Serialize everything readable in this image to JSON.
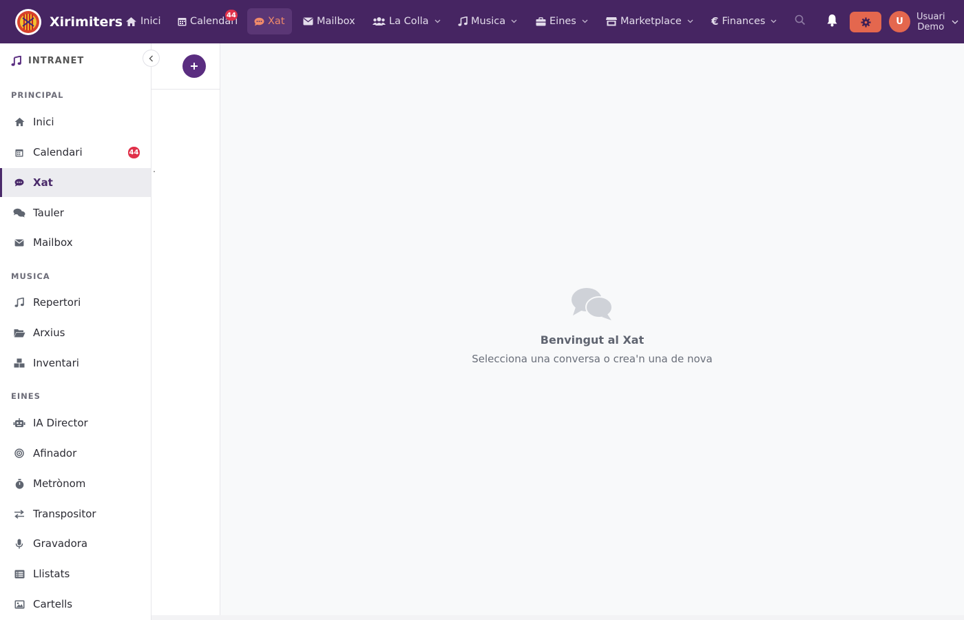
{
  "app": {
    "brand": "Xirimiters"
  },
  "topnav": {
    "items": [
      {
        "label": "Inici",
        "icon": "home-icon"
      },
      {
        "label": "Calendari",
        "icon": "calendar-icon",
        "badge": "44"
      },
      {
        "label": "Xat",
        "icon": "chat-icon",
        "active": true
      },
      {
        "label": "Mailbox",
        "icon": "envelope-icon"
      },
      {
        "label": "La Colla",
        "icon": "users-icon"
      },
      {
        "label": "Musica",
        "icon": "music-icon"
      },
      {
        "label": "Eines",
        "icon": "toolbox-icon"
      },
      {
        "label": "Marketplace",
        "icon": "store-icon"
      },
      {
        "label": "Finances",
        "icon": "euro-icon"
      }
    ],
    "user": {
      "initial": "U",
      "name_line1": "Usuari",
      "name_line2": "Demo"
    }
  },
  "sidebar": {
    "header": "INTRANET",
    "sections": [
      {
        "title": "PRINCIPAL",
        "items": [
          {
            "label": "Inici",
            "icon": "home-icon"
          },
          {
            "label": "Calendari",
            "icon": "calendar-icon",
            "badge": "44"
          },
          {
            "label": "Xat",
            "icon": "chat-icon",
            "active": true
          },
          {
            "label": "Tauler",
            "icon": "comments-icon"
          },
          {
            "label": "Mailbox",
            "icon": "envelope-icon"
          }
        ]
      },
      {
        "title": "MUSICA",
        "items": [
          {
            "label": "Repertori",
            "icon": "music-icon"
          },
          {
            "label": "Arxius",
            "icon": "folder-open-icon"
          },
          {
            "label": "Inventari",
            "icon": "boxes-icon"
          }
        ]
      },
      {
        "title": "EINES",
        "items": [
          {
            "label": "IA Director",
            "icon": "robot-icon"
          },
          {
            "label": "Afinador",
            "icon": "target-icon"
          },
          {
            "label": "Metrònom",
            "icon": "stopwatch-icon"
          },
          {
            "label": "Transpositor",
            "icon": "exchange-icon"
          },
          {
            "label": "Gravadora",
            "icon": "microphone-icon"
          },
          {
            "label": "Llistats",
            "icon": "list-icon"
          },
          {
            "label": "Cartells",
            "icon": "image-icon"
          }
        ]
      }
    ]
  },
  "main": {
    "empty_title": "Benvingut al Xat",
    "empty_subtitle": "Selecciona una conversa o crea'n una de nova"
  },
  "colors": {
    "navbar": "#462562",
    "accent": "#e4674e",
    "primary": "#5a2d80",
    "badge": "#e0314a"
  }
}
